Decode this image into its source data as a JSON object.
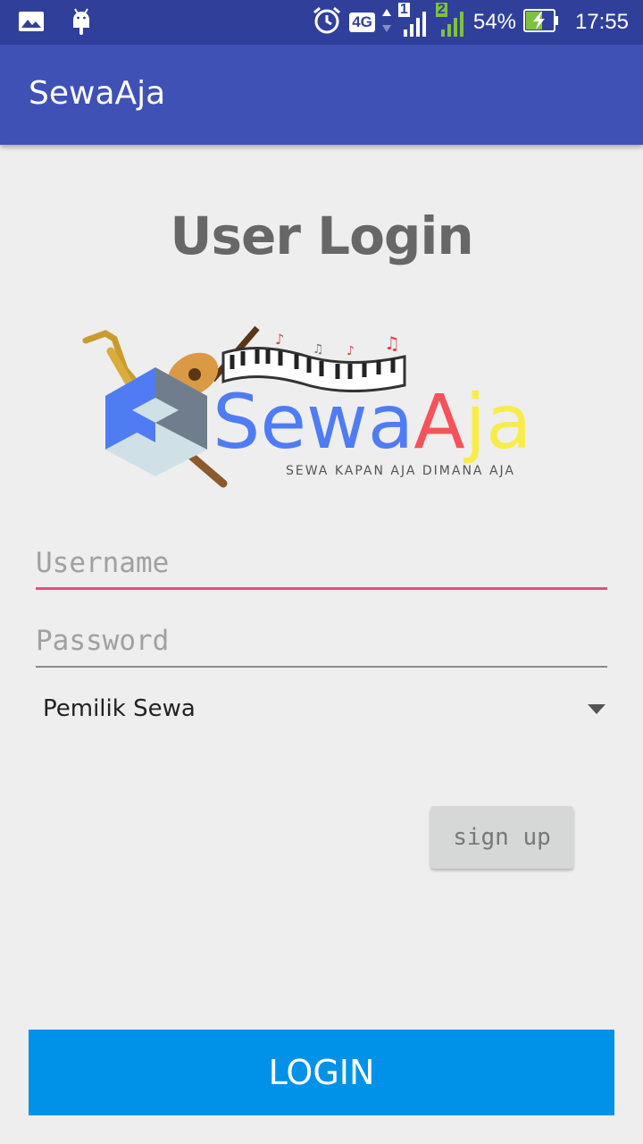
{
  "status_bar": {
    "network_type": "4G",
    "sim1": "1",
    "sim2": "2",
    "battery": "54%",
    "time": "17:55",
    "icons": [
      "image-icon",
      "android-icon",
      "alarm-icon",
      "signal-icon",
      "battery-charging-icon"
    ]
  },
  "app_bar": {
    "title": "SewaAja"
  },
  "heading": "User Login",
  "logo": {
    "word_part1": "Sewa",
    "word_part2": "A",
    "word_part3": "ja",
    "tagline": "SEWA KAPAN AJA DIMANA AJA",
    "colors": {
      "blue": "#4f7cf3",
      "red": "#f5535a",
      "yellow": "#f8ec4a"
    }
  },
  "form": {
    "username_placeholder": "Username",
    "password_placeholder": "Password",
    "role_selected": "Pemilik Sewa"
  },
  "buttons": {
    "signup": "sign up",
    "login": "LOGIN"
  },
  "colors": {
    "status_bar": "#30409a",
    "app_bar": "#3f51b5",
    "focus_underline": "#ee4b80",
    "login_button": "#0092e8"
  }
}
